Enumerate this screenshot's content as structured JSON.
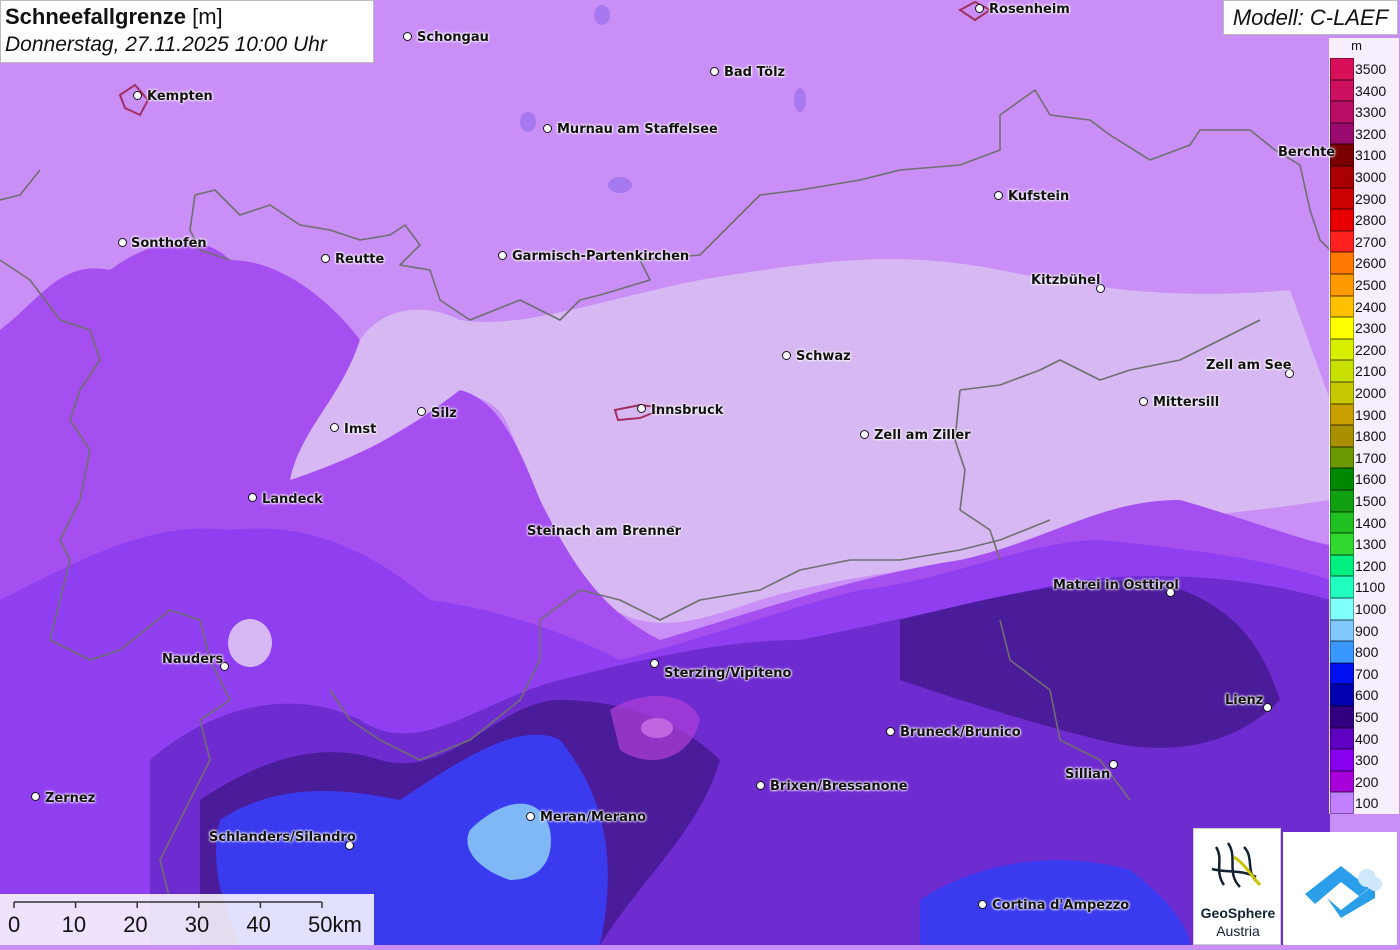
{
  "title": {
    "main": "Schneefallgrenze",
    "unit": "[m]",
    "date": "Donnerstag, 27.11.2025 10:00 Uhr"
  },
  "model": "Modell: C-LAEF",
  "legend": {
    "unit": "m",
    "items": [
      {
        "label": "3500",
        "color": "#d8105a"
      },
      {
        "label": "3400",
        "color": "#cc0f5e"
      },
      {
        "label": "3300",
        "color": "#b80d66"
      },
      {
        "label": "3200",
        "color": "#990a6e"
      },
      {
        "label": "3100",
        "color": "#7a0000"
      },
      {
        "label": "3000",
        "color": "#a80000"
      },
      {
        "label": "2900",
        "color": "#cc0000"
      },
      {
        "label": "2800",
        "color": "#e80000"
      },
      {
        "label": "2700",
        "color": "#ff2020"
      },
      {
        "label": "2600",
        "color": "#ff7800"
      },
      {
        "label": "2500",
        "color": "#ff9a00"
      },
      {
        "label": "2400",
        "color": "#ffc000"
      },
      {
        "label": "2300",
        "color": "#ffff00"
      },
      {
        "label": "2200",
        "color": "#d8f000"
      },
      {
        "label": "2100",
        "color": "#c8e000"
      },
      {
        "label": "2000",
        "color": "#c8c800"
      },
      {
        "label": "1900",
        "color": "#c8a000"
      },
      {
        "label": "1800",
        "color": "#a89000"
      },
      {
        "label": "1700",
        "color": "#6a9a00"
      },
      {
        "label": "1600",
        "color": "#008800"
      },
      {
        "label": "1500",
        "color": "#10a010"
      },
      {
        "label": "1400",
        "color": "#20c020"
      },
      {
        "label": "1300",
        "color": "#30d830"
      },
      {
        "label": "1200",
        "color": "#00f080"
      },
      {
        "label": "1100",
        "color": "#20ffc0"
      },
      {
        "label": "1000",
        "color": "#80ffff"
      },
      {
        "label": "900",
        "color": "#80c8ff"
      },
      {
        "label": "800",
        "color": "#3898ff"
      },
      {
        "label": "700",
        "color": "#0010f0"
      },
      {
        "label": "600",
        "color": "#0000b0"
      },
      {
        "label": "500",
        "color": "#300080"
      },
      {
        "label": "400",
        "color": "#6000c0"
      },
      {
        "label": "300",
        "color": "#8800f0"
      },
      {
        "label": "200",
        "color": "#a800d8"
      },
      {
        "label": "100",
        "color": "#c080ff"
      }
    ]
  },
  "scale_bar": {
    "ticks": [
      "0",
      "10",
      "20",
      "30",
      "40",
      "50km"
    ]
  },
  "cities": [
    {
      "name": "Rosenheim",
      "id": "rosenheim"
    },
    {
      "name": "Schongau",
      "id": "schongau"
    },
    {
      "name": "Bad Tölz",
      "id": "bad-toelz"
    },
    {
      "name": "Kempten",
      "id": "kempten"
    },
    {
      "name": "Murnau am Staffelsee",
      "id": "murnau"
    },
    {
      "name": "Berchte",
      "id": "berchtesgaden"
    },
    {
      "name": "Kufstein",
      "id": "kufstein"
    },
    {
      "name": "Sonthofen",
      "id": "sonthofen"
    },
    {
      "name": "Reutte",
      "id": "reutte"
    },
    {
      "name": "Garmisch-Partenkirchen",
      "id": "garmisch"
    },
    {
      "name": "Kitzbühel",
      "id": "kitzbuehel"
    },
    {
      "name": "Schwaz",
      "id": "schwaz"
    },
    {
      "name": "Zell am See",
      "id": "zell-am-see"
    },
    {
      "name": "Mittersill",
      "id": "mittersill"
    },
    {
      "name": "Silz",
      "id": "silz"
    },
    {
      "name": "Innsbruck",
      "id": "innsbruck"
    },
    {
      "name": "Imst",
      "id": "imst"
    },
    {
      "name": "Zell am Ziller",
      "id": "zell-am-ziller"
    },
    {
      "name": "Landeck",
      "id": "landeck"
    },
    {
      "name": "Steinach am Brenner",
      "id": "steinach"
    },
    {
      "name": "Matrei in Osttirol",
      "id": "matrei"
    },
    {
      "name": "Nauders",
      "id": "nauders"
    },
    {
      "name": "Sterzing/Vipiteno",
      "id": "sterzing"
    },
    {
      "name": "Lienz",
      "id": "lienz"
    },
    {
      "name": "Bruneck/Brunico",
      "id": "bruneck"
    },
    {
      "name": "Sillian",
      "id": "sillian"
    },
    {
      "name": "Brixen/Bressanone",
      "id": "brixen"
    },
    {
      "name": "Zernez",
      "id": "zernez"
    },
    {
      "name": "Meran/Merano",
      "id": "meran"
    },
    {
      "name": "Schlanders/Silandro",
      "id": "schlanders"
    },
    {
      "name": "Cortina d'Ampezzo",
      "id": "cortina"
    }
  ],
  "logos": {
    "geosphere_name": "GeoSphere",
    "geosphere_sub": "Austria"
  }
}
